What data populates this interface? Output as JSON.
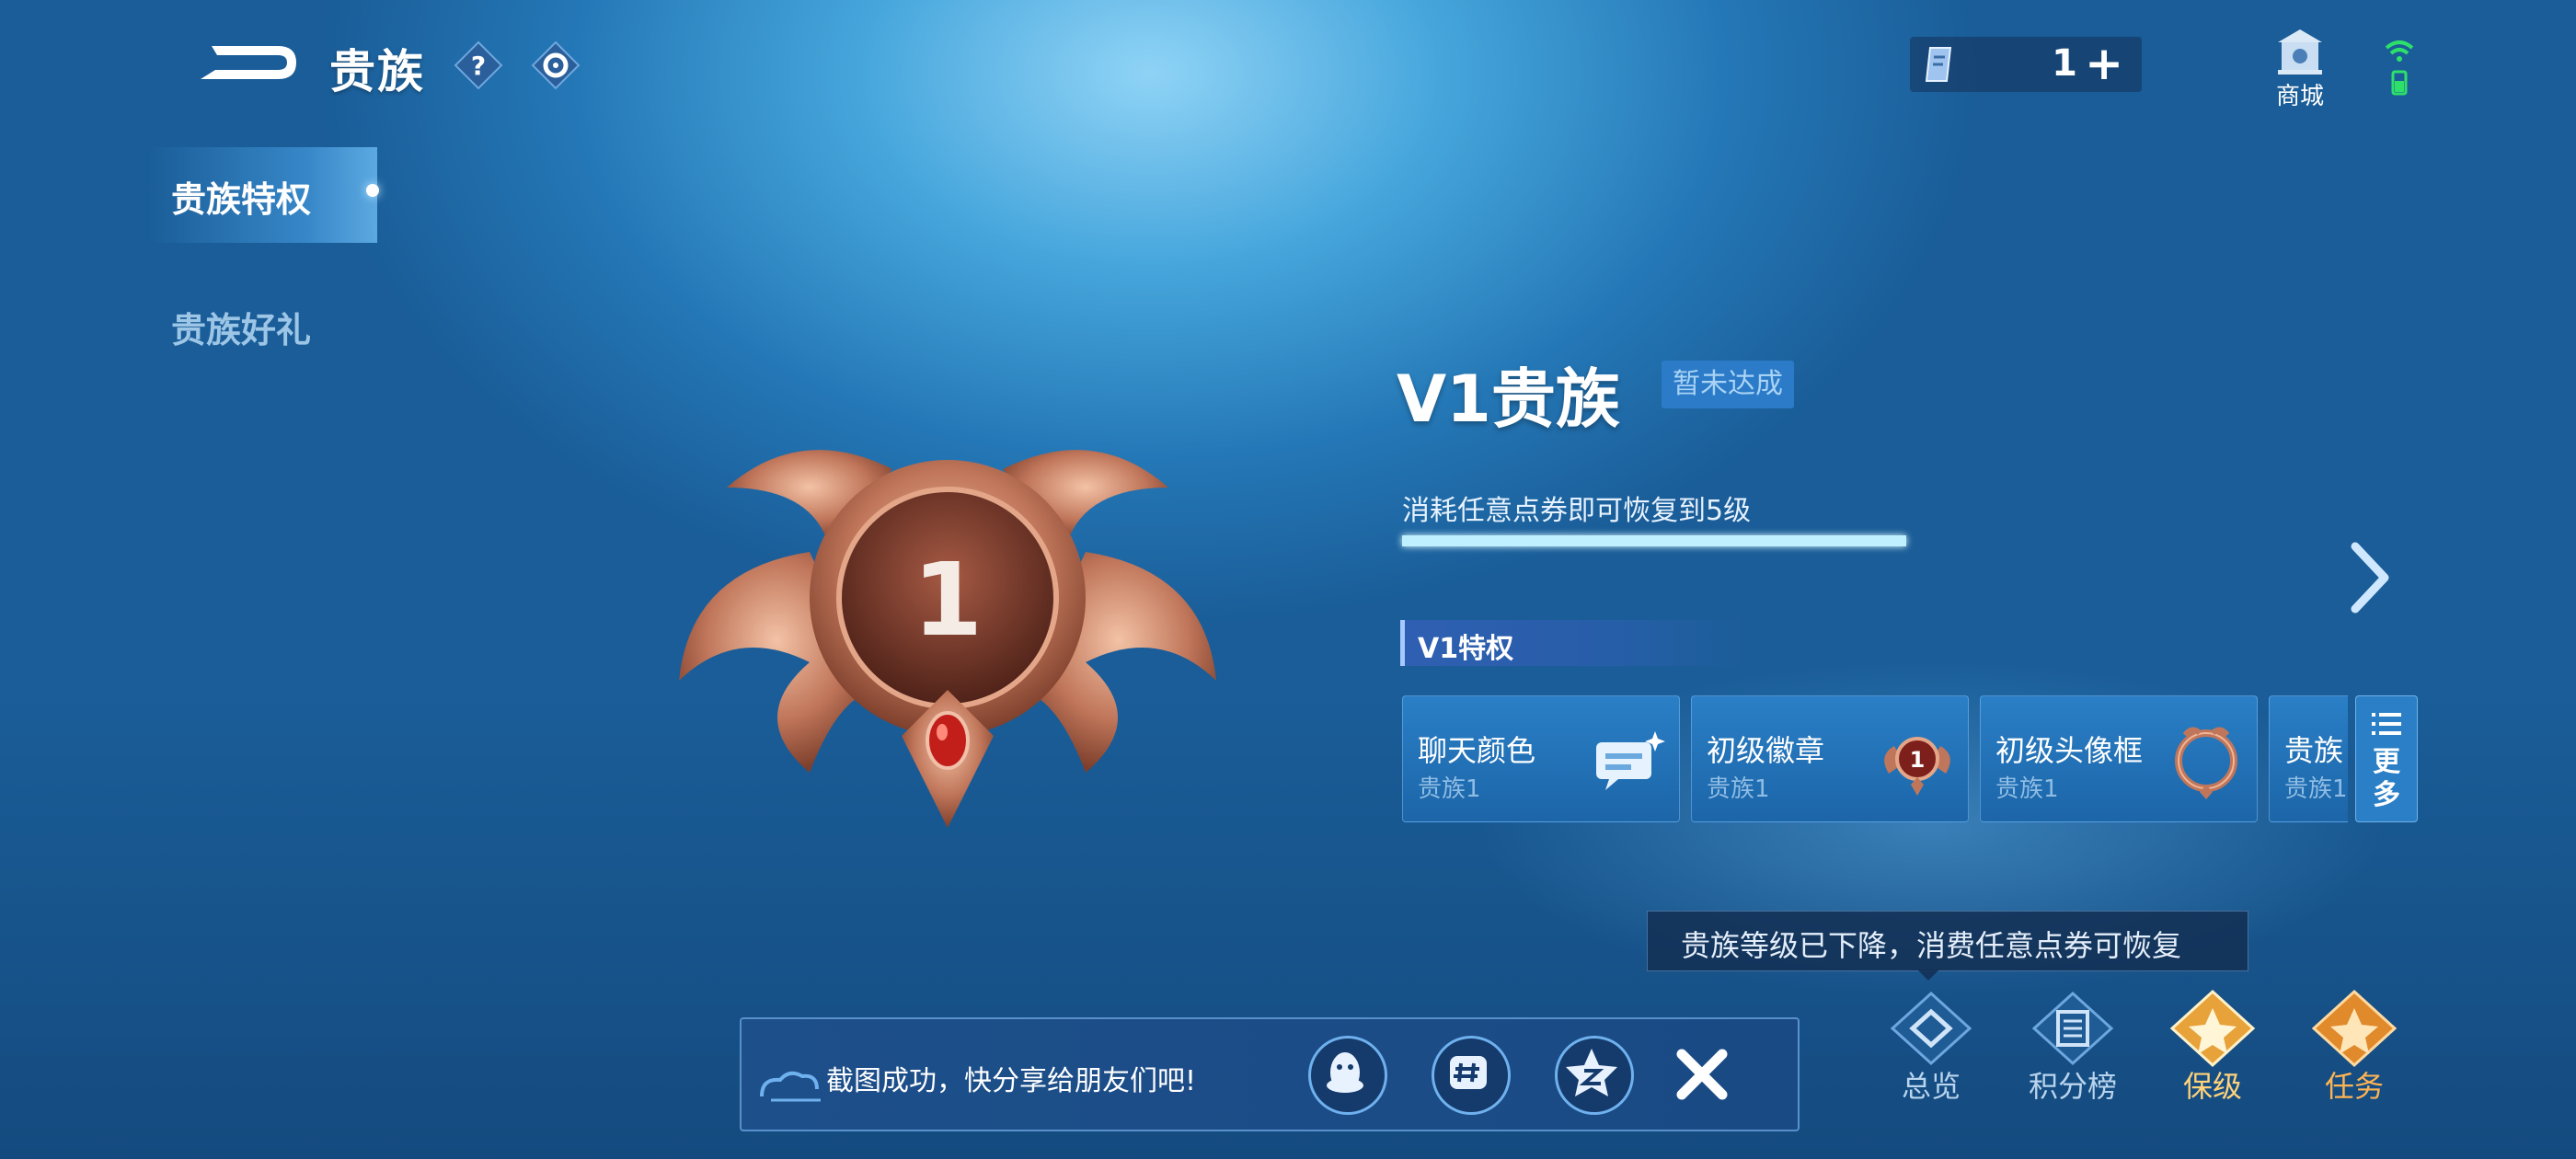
{
  "header": {
    "title": "贵族",
    "currency_value": "1",
    "currency_plus": "+",
    "shop_label": "商城"
  },
  "sidebar": {
    "items": [
      {
        "label": "贵族特权",
        "active": true
      },
      {
        "label": "贵族好礼",
        "active": false
      }
    ]
  },
  "level": {
    "badge_number": "1",
    "title": "V1贵族",
    "status": "暂未达成",
    "hint": "消耗任意点券即可恢复到5级",
    "progress": 1.0
  },
  "privileges": {
    "header": "V1特权",
    "cards": [
      {
        "name": "聊天颜色",
        "sub": "贵族1",
        "icon": "chat-bubble-icon"
      },
      {
        "name": "初级徽章",
        "sub": "贵族1",
        "icon": "badge-icon",
        "icon_text": "1"
      },
      {
        "name": "初级头像框",
        "sub": "贵族1",
        "icon": "avatar-frame-icon"
      },
      {
        "name": "贵族",
        "sub": "贵族1",
        "icon": "none"
      }
    ],
    "more_label": "更多"
  },
  "tooltip": "贵族等级已下降，消费任意点券可恢复",
  "tabs": [
    {
      "label": "总览",
      "icon": "overview-icon",
      "color": "#1f5b95"
    },
    {
      "label": "积分榜",
      "icon": "leaderboard-icon",
      "color": "#1f5b95"
    },
    {
      "label": "保级",
      "icon": "keep-level-icon",
      "color": "#e8a23a"
    },
    {
      "label": "任务",
      "icon": "task-icon",
      "color": "#e08a2c"
    }
  ],
  "toast": {
    "text": "截图成功，快分享给朋友们吧!",
    "share_icons": [
      "qq-icon",
      "wechat-moments-icon",
      "qzone-icon"
    ]
  },
  "colors": {
    "accent": "#2c7bc8",
    "badge_bronze": "#c0765a",
    "active_tab": "#e8a23a"
  }
}
